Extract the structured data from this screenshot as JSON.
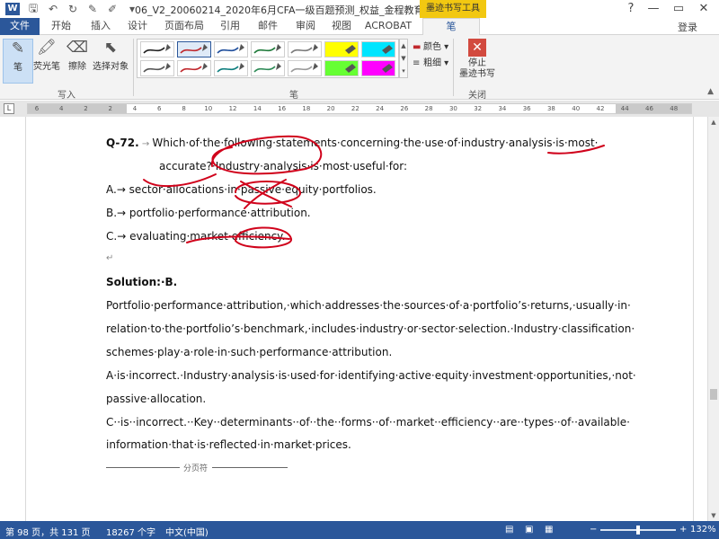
{
  "titlebar": {
    "quick_access": [
      {
        "icon": "word-app-icon",
        "glyph": "W"
      },
      {
        "icon": "save-icon",
        "glyph": "🖫"
      },
      {
        "icon": "undo-icon",
        "glyph": "↶"
      },
      {
        "icon": "redo-icon",
        "glyph": "↻"
      },
      {
        "icon": "pen-icon",
        "glyph": "✎"
      },
      {
        "icon": "highlighter-icon",
        "glyph": "✐"
      },
      {
        "icon": "customize-dropdown-icon",
        "glyph": "▾"
      }
    ],
    "document_title": "06_V2_20060214_2020年6月CFA一级百题预测_权益_金程教育（授...",
    "context_tab": "墨迹书写工具",
    "help": "?",
    "minimize": "—",
    "restore": "▭",
    "close": "✕"
  },
  "tabs": {
    "file": "文件",
    "items": [
      "开始",
      "插入",
      "设计",
      "页面布局",
      "引用",
      "邮件",
      "审阅",
      "视图",
      "ACROBAT",
      "笔"
    ],
    "active": "笔",
    "login": "登录"
  },
  "ribbon": {
    "write_group": {
      "label": "写入",
      "buttons": [
        {
          "label": "笔",
          "icon": "pen-icon",
          "glyph": "✎",
          "selected": true
        },
        {
          "label": "荧光笔",
          "icon": "highlighter-icon",
          "glyph": "🖍",
          "selected": false
        },
        {
          "label": "擦除",
          "icon": "eraser-icon",
          "glyph": "⌫",
          "selected": false
        },
        {
          "label": "选择对象",
          "icon": "select-objects-icon",
          "glyph": "⬉",
          "selected": false
        }
      ]
    },
    "pens_group": {
      "label": "笔",
      "pens": [
        {
          "color": "#222222",
          "selected": false
        },
        {
          "color": "#c0282d",
          "selected": true
        },
        {
          "color": "#1f4e9c",
          "selected": false
        },
        {
          "color": "#1e7a3a",
          "selected": false
        },
        {
          "color": "#7a7a7a",
          "selected": false
        },
        {
          "color": "#ffff00",
          "selected": false,
          "highlight": true
        },
        {
          "color": "#00e5ff",
          "selected": false,
          "highlight": true
        },
        {
          "color": "#555555",
          "selected": false
        },
        {
          "color": "#c0282d",
          "selected": false
        },
        {
          "color": "#0f7f7f",
          "selected": false
        },
        {
          "color": "#2e8b57",
          "selected": false
        },
        {
          "color": "#9a9a9a",
          "selected": false
        },
        {
          "color": "#66ff33",
          "selected": false,
          "highlight": true
        },
        {
          "color": "#ff00ff",
          "selected": false,
          "highlight": true
        }
      ],
      "color_label": "颜色",
      "thickness_label": "粗细"
    },
    "close_group": {
      "label": "关闭",
      "stop_label_1": "停止",
      "stop_label_2": "墨迹书写"
    }
  },
  "ruler": {
    "marker": "L",
    "ticks": [
      "6",
      "4",
      "2",
      "2",
      "4",
      "6",
      "8",
      "10",
      "12",
      "14",
      "16",
      "18",
      "20",
      "22",
      "24",
      "26",
      "28",
      "30",
      "32",
      "34",
      "36",
      "38",
      "40",
      "42",
      "44",
      "46",
      "48"
    ]
  },
  "document": {
    "question_num": "Q-72.",
    "question_text_1": "Which·of·the·following·statements·concerning·the·use·of·industry·analysis·is·most·",
    "question_text_2": "accurate?·Industry·analysis·is·most·useful·for:",
    "option_a": "A.→ sector·allocations·in·passive·equity·portfolios.",
    "option_b": "B.→ portfolio·performance·attribution.",
    "option_c": "C.→ evaluating·market·efficiency.",
    "solution": "Solution:·B.",
    "para_1": "Portfolio·performance·attribution,·which·addresses·the·sources·of·a·portfolio’s·returns,·usually·in·",
    "para_2": "relation·to·the·portfolio’s·benchmark,·includes·industry·or·sector·selection.·Industry·classification·",
    "para_3": "schemes·play·a·role·in·such·performance·attribution.",
    "para_4": "A·is·incorrect.·Industry·analysis·is·used·for·identifying·active·equity·investment·opportunities,·not·",
    "para_5": "passive·allocation.",
    "para_6": "C··is··incorrect.··Key··determinants··of··the··forms··of··market··efficiency··are··types··of··available·",
    "para_7": "information·that·is·reflected·in·market·prices.",
    "page_break": "分页符"
  },
  "statusbar": {
    "page_info": "第 98 页，共 131 页",
    "word_count": "18267 个字",
    "language": "中文(中国)",
    "zoom_minus": "−",
    "zoom_plus": "+",
    "zoom_level": "132%",
    "zoom_fraction": 0.5
  }
}
